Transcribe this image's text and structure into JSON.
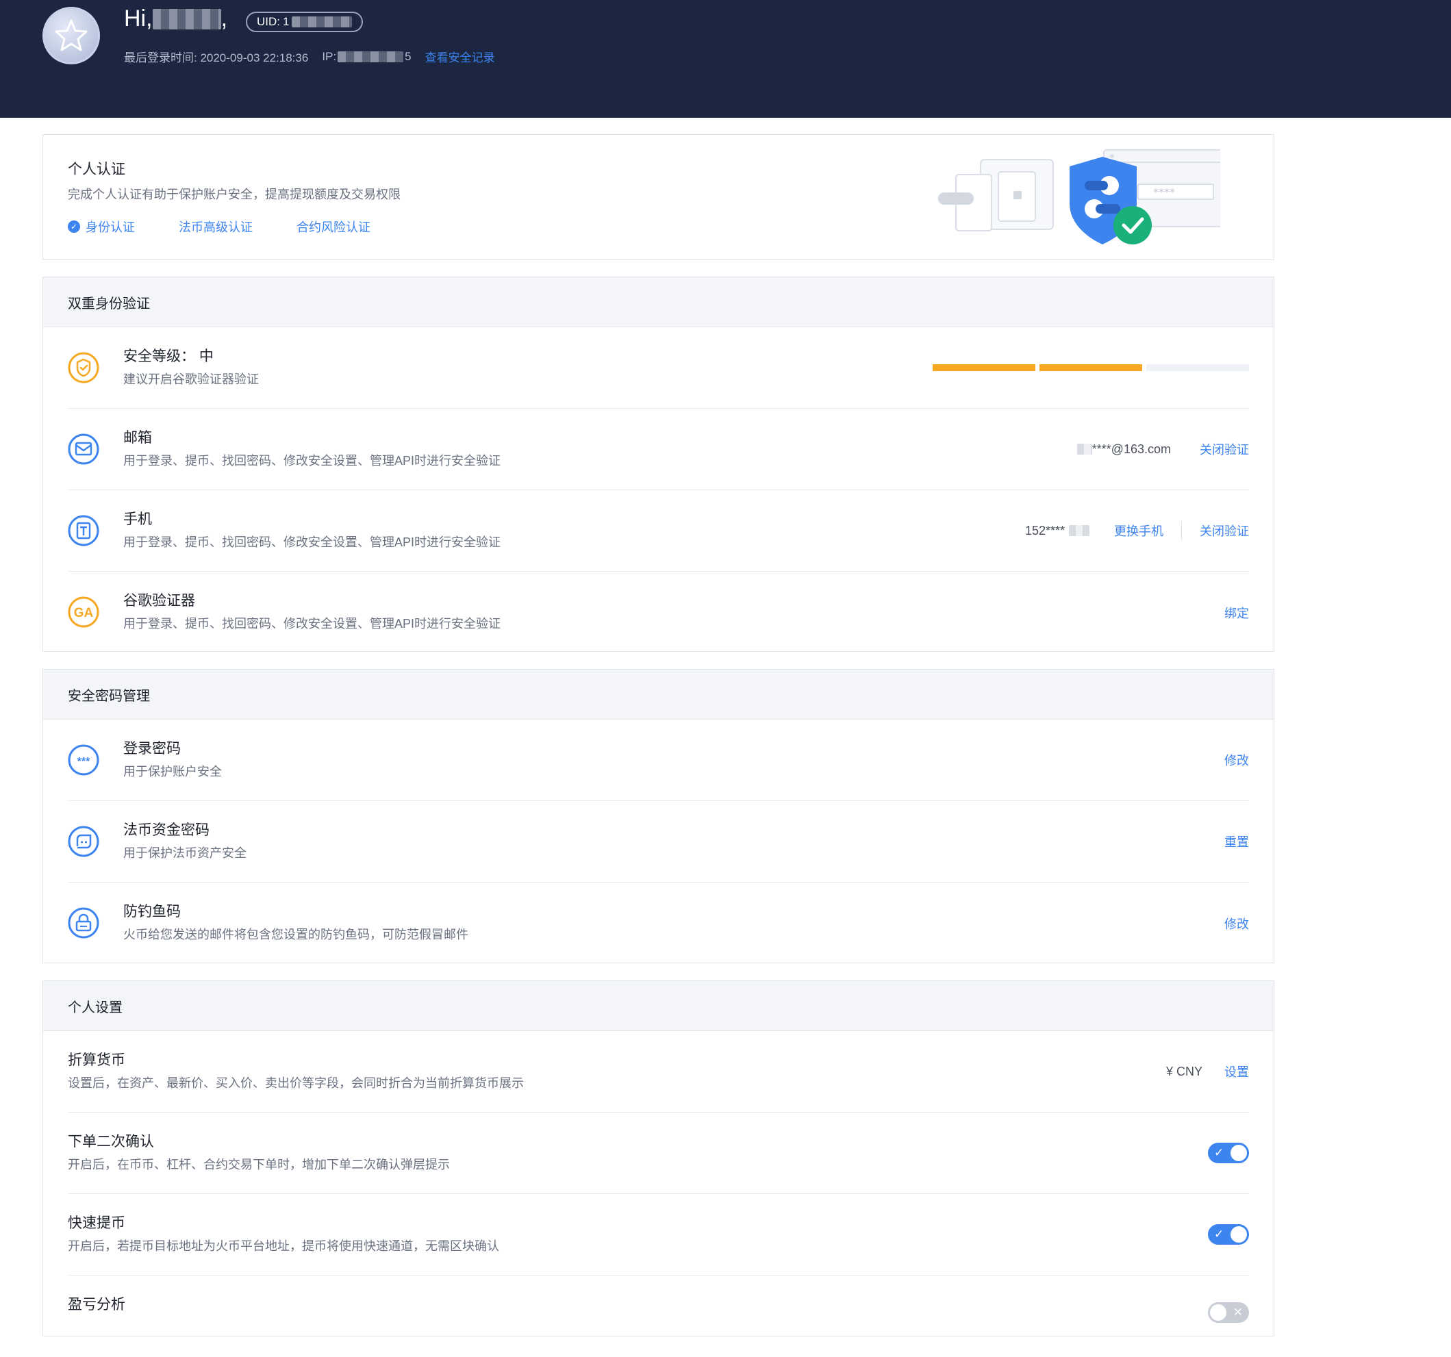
{
  "header": {
    "greeting": "Hi,",
    "greeting_suffix": ",",
    "uid_label": "UID:",
    "uid_value": "1",
    "last_login_label": "最后登录时间: 2020-09-03 22:18:36",
    "ip_label": "IP:",
    "ip_value_tail": "5",
    "security_log_link": "查看安全记录"
  },
  "verification": {
    "title": "个人认证",
    "desc": "完成个人认证有助于保护账户安全，提高提现额度及交易权限",
    "links": [
      {
        "label": "身份认证",
        "verified": true
      },
      {
        "label": "法币高级认证",
        "verified": false
      },
      {
        "label": "合约风险认证",
        "verified": false
      }
    ]
  },
  "two_factor": {
    "section_title": "双重身份验证",
    "level": {
      "title": "安全等级：  中",
      "desc": "建议开启谷歌验证器验证",
      "level_filled": 2,
      "level_total": 3
    },
    "email": {
      "title": "邮箱",
      "desc": "用于登录、提币、找回密码、修改安全设置、管理API时进行安全验证",
      "value": "****@163.com",
      "action": "关闭验证"
    },
    "phone": {
      "title": "手机",
      "desc": "用于登录、提币、找回密码、修改安全设置、管理API时进行安全验证",
      "value": "152****",
      "action_change": "更换手机",
      "action_close": "关闭验证"
    },
    "google": {
      "title": "谷歌验证器",
      "desc": "用于登录、提币、找回密码、修改安全设置、管理API时进行安全验证",
      "action": "绑定",
      "icon_text": "GA"
    }
  },
  "passwords": {
    "section_title": "安全密码管理",
    "login": {
      "title": "登录密码",
      "desc": "用于保护账户安全",
      "action": "修改",
      "icon_text": "***"
    },
    "fiat": {
      "title": "法币资金密码",
      "desc": "用于保护法币资产安全",
      "action": "重置"
    },
    "anti_phishing": {
      "title": "防钓鱼码",
      "desc": "火币给您发送的邮件将包含您设置的防钓鱼码，可防范假冒邮件",
      "action": "修改"
    }
  },
  "settings": {
    "section_title": "个人设置",
    "currency": {
      "title": "折算货币",
      "desc": "设置后，在资产、最新价、买入价、卖出价等字段，会同时折合为当前折算货币展示",
      "value": "¥ CNY",
      "action": "设置"
    },
    "order_confirm": {
      "title": "下单二次确认",
      "desc": "开启后，在币币、杠杆、合约交易下单时，增加下单二次确认弹层提示",
      "enabled": true
    },
    "fast_withdraw": {
      "title": "快速提币",
      "desc": "开启后，若提币目标地址为火币平台地址，提币将使用快速通道，无需区块确认",
      "enabled": true
    },
    "pnl": {
      "title": "盈亏分析",
      "enabled": false
    }
  },
  "colors": {
    "accent": "#3d84ef",
    "warning": "#f6a823",
    "header_bg": "#1d2640"
  },
  "icons": {
    "toggle_on": "✓",
    "toggle_off": "✕",
    "verified": "✓"
  }
}
